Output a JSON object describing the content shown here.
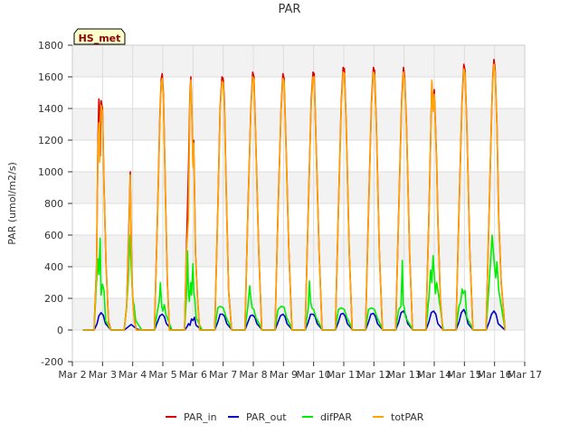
{
  "chart_data": {
    "type": "line",
    "title": "PAR",
    "xlabel": "",
    "ylabel": "PAR (umol/m2/s)",
    "ylim": [
      -200,
      1800
    ],
    "xlim": [
      0,
      15
    ],
    "yticks": [
      -200,
      0,
      200,
      400,
      600,
      800,
      1000,
      1200,
      1400,
      1600,
      1800
    ],
    "xticks": [
      {
        "x": 0,
        "label": "Mar 2"
      },
      {
        "x": 1,
        "label": "Mar 3"
      },
      {
        "x": 2,
        "label": "Mar 4"
      },
      {
        "x": 3,
        "label": "Mar 5"
      },
      {
        "x": 4,
        "label": "Mar 6"
      },
      {
        "x": 5,
        "label": "Mar 7"
      },
      {
        "x": 6,
        "label": "Mar 8"
      },
      {
        "x": 7,
        "label": "Mar 9"
      },
      {
        "x": 8,
        "label": "Mar 10"
      },
      {
        "x": 9,
        "label": "Mar 11"
      },
      {
        "x": 10,
        "label": "Mar 12"
      },
      {
        "x": 11,
        "label": "Mar 13"
      },
      {
        "x": 12,
        "label": "Mar 14"
      },
      {
        "x": 13,
        "label": "Mar 15"
      },
      {
        "x": 14,
        "label": "Mar 16"
      },
      {
        "x": 15,
        "label": "Mar 17"
      }
    ],
    "grid": true,
    "legend_position": "bottom",
    "annotation": "HS_met",
    "series": [
      {
        "name": "PAR_in",
        "color": "#dd0000",
        "x": [
          0.35,
          0.72,
          0.8,
          0.85,
          0.88,
          0.9,
          0.92,
          0.95,
          1.0,
          1.05,
          1.12,
          1.2,
          1.28,
          1.72,
          1.8,
          1.88,
          1.92,
          1.95,
          1.98,
          2.02,
          2.06,
          2.12,
          2.22,
          2.3,
          2.72,
          2.82,
          2.9,
          2.95,
          2.98,
          3.02,
          3.08,
          3.15,
          3.22,
          3.3,
          3.72,
          3.78,
          3.85,
          3.9,
          3.93,
          3.96,
          4.0,
          4.02,
          4.05,
          4.08,
          4.15,
          4.22,
          4.3,
          4.72,
          4.82,
          4.9,
          4.96,
          5.0,
          5.04,
          5.1,
          5.18,
          5.28,
          5.72,
          5.82,
          5.92,
          5.98,
          6.02,
          6.08,
          6.18,
          6.28,
          6.72,
          6.82,
          6.92,
          6.98,
          7.02,
          7.08,
          7.18,
          7.28,
          7.72,
          7.82,
          7.92,
          7.98,
          8.02,
          8.08,
          8.18,
          8.28,
          8.72,
          8.82,
          8.92,
          8.98,
          9.02,
          9.08,
          9.18,
          9.28,
          9.72,
          9.82,
          9.92,
          9.98,
          10.02,
          10.08,
          10.18,
          10.28,
          10.72,
          10.82,
          10.92,
          10.98,
          11.02,
          11.08,
          11.18,
          11.28,
          11.72,
          11.82,
          11.88,
          11.92,
          11.96,
          12.0,
          12.04,
          12.08,
          12.12,
          12.2,
          12.28,
          12.72,
          12.82,
          12.92,
          12.98,
          13.02,
          13.08,
          13.18,
          13.28,
          13.72,
          13.82,
          13.9,
          13.94,
          13.98,
          14.02,
          14.08,
          14.14,
          14.22,
          14.35
        ],
        "y": [
          0,
          0,
          400,
          1200,
          1460,
          1400,
          1100,
          1450,
          1400,
          900,
          400,
          50,
          0,
          0,
          150,
          700,
          1000,
          600,
          300,
          150,
          60,
          0,
          0,
          0,
          0,
          700,
          1350,
          1590,
          1620,
          1480,
          900,
          300,
          0,
          0,
          0,
          500,
          1000,
          1500,
          1600,
          1400,
          1050,
          1200,
          900,
          500,
          200,
          0,
          0,
          0,
          750,
          1400,
          1600,
          1590,
          1450,
          900,
          250,
          0,
          0,
          750,
          1400,
          1630,
          1600,
          1200,
          500,
          0,
          0,
          750,
          1400,
          1620,
          1590,
          1200,
          500,
          0,
          0,
          750,
          1450,
          1630,
          1620,
          1200,
          500,
          0,
          0,
          750,
          1450,
          1660,
          1650,
          1300,
          500,
          0,
          0,
          750,
          1450,
          1660,
          1640,
          1300,
          500,
          0,
          0,
          750,
          1450,
          1660,
          1600,
          1300,
          500,
          0,
          0,
          700,
          1200,
          1570,
          1400,
          1520,
          1300,
          1050,
          700,
          200,
          0,
          0,
          750,
          1450,
          1680,
          1640,
          1300,
          500,
          0,
          0,
          750,
          1350,
          1600,
          1710,
          1650,
          1300,
          700,
          300,
          0
        ]
      },
      {
        "name": "PAR_out",
        "color": "#0000cc",
        "x": [
          0.35,
          0.72,
          0.82,
          0.88,
          0.95,
          1.02,
          1.1,
          1.28,
          1.72,
          1.85,
          1.95,
          2.05,
          2.15,
          2.3,
          2.72,
          2.82,
          2.9,
          2.98,
          3.05,
          3.12,
          3.3,
          3.72,
          3.8,
          3.85,
          3.9,
          3.95,
          4.0,
          4.05,
          4.1,
          4.3,
          4.72,
          4.82,
          4.9,
          4.98,
          5.05,
          5.12,
          5.3,
          5.72,
          5.82,
          5.9,
          5.98,
          6.05,
          6.12,
          6.3,
          6.72,
          6.82,
          6.9,
          6.98,
          7.05,
          7.12,
          7.3,
          7.72,
          7.82,
          7.9,
          7.98,
          8.05,
          8.12,
          8.3,
          8.72,
          8.82,
          8.9,
          8.98,
          9.05,
          9.12,
          9.3,
          9.72,
          9.82,
          9.9,
          9.98,
          10.05,
          10.12,
          10.3,
          10.72,
          10.82,
          10.9,
          10.98,
          11.05,
          11.12,
          11.3,
          11.72,
          11.82,
          11.9,
          11.98,
          12.05,
          12.12,
          12.3,
          12.72,
          12.82,
          12.9,
          12.98,
          13.05,
          13.12,
          13.3,
          13.72,
          13.82,
          13.9,
          13.98,
          14.05,
          14.12,
          14.35
        ],
        "y": [
          0,
          0,
          40,
          90,
          110,
          95,
          40,
          0,
          0,
          20,
          35,
          20,
          5,
          0,
          0,
          50,
          90,
          100,
          85,
          40,
          0,
          0,
          20,
          40,
          30,
          70,
          60,
          80,
          30,
          0,
          0,
          50,
          100,
          100,
          85,
          40,
          0,
          0,
          50,
          90,
          95,
          80,
          40,
          0,
          0,
          50,
          90,
          100,
          85,
          40,
          0,
          0,
          50,
          100,
          100,
          85,
          40,
          0,
          0,
          50,
          100,
          105,
          85,
          40,
          0,
          0,
          50,
          100,
          105,
          85,
          40,
          0,
          0,
          50,
          110,
          120,
          95,
          40,
          0,
          0,
          50,
          110,
          120,
          100,
          40,
          0,
          0,
          50,
          110,
          130,
          100,
          40,
          0,
          0,
          50,
          100,
          120,
          100,
          40,
          0
        ]
      },
      {
        "name": "difPAR",
        "color": "#00ee00",
        "x": [
          0.35,
          0.72,
          0.8,
          0.85,
          0.88,
          0.92,
          0.95,
          1.0,
          1.05,
          1.1,
          1.28,
          1.72,
          1.8,
          1.85,
          1.9,
          1.95,
          2.0,
          2.05,
          2.1,
          2.3,
          2.72,
          2.82,
          2.88,
          2.92,
          2.96,
          3.0,
          3.05,
          3.1,
          3.3,
          3.72,
          3.78,
          3.82,
          3.85,
          3.88,
          3.92,
          3.95,
          4.0,
          4.03,
          4.06,
          4.1,
          4.3,
          4.72,
          4.82,
          4.9,
          5.0,
          5.1,
          5.3,
          5.72,
          5.82,
          5.88,
          5.92,
          5.96,
          6.02,
          6.08,
          6.3,
          6.72,
          6.82,
          6.92,
          7.02,
          7.1,
          7.3,
          7.72,
          7.82,
          7.86,
          7.9,
          7.94,
          8.0,
          8.08,
          8.3,
          8.72,
          8.82,
          8.92,
          9.02,
          9.1,
          9.3,
          9.72,
          9.82,
          9.92,
          10.02,
          10.1,
          10.3,
          10.72,
          10.82,
          10.9,
          10.94,
          10.97,
          11.0,
          11.05,
          11.3,
          11.72,
          11.82,
          11.88,
          11.92,
          11.96,
          12.0,
          12.04,
          12.08,
          12.12,
          12.3,
          12.72,
          12.82,
          12.88,
          12.92,
          12.96,
          13.02,
          13.08,
          13.3,
          13.72,
          13.82,
          13.88,
          13.92,
          13.96,
          14.0,
          14.04,
          14.08,
          14.14,
          14.35
        ],
        "y": [
          0,
          0,
          300,
          450,
          350,
          580,
          220,
          290,
          250,
          60,
          0,
          0,
          150,
          300,
          600,
          400,
          200,
          150,
          60,
          0,
          0,
          120,
          180,
          300,
          150,
          120,
          160,
          100,
          0,
          0,
          200,
          500,
          250,
          180,
          300,
          220,
          420,
          230,
          200,
          80,
          0,
          0,
          140,
          150,
          140,
          80,
          0,
          0,
          150,
          280,
          200,
          140,
          130,
          80,
          0,
          0,
          130,
          150,
          145,
          80,
          0,
          0,
          140,
          310,
          180,
          140,
          130,
          80,
          0,
          0,
          130,
          140,
          130,
          80,
          0,
          0,
          130,
          140,
          130,
          80,
          0,
          0,
          130,
          150,
          440,
          160,
          150,
          80,
          0,
          0,
          200,
          380,
          300,
          470,
          350,
          230,
          300,
          250,
          0,
          0,
          150,
          180,
          260,
          230,
          250,
          80,
          0,
          0,
          300,
          480,
          600,
          500,
          400,
          330,
          430,
          250,
          0
        ]
      },
      {
        "name": "totPAR",
        "color": "#ffa500",
        "x": [
          0.35,
          0.72,
          0.8,
          0.85,
          0.88,
          0.9,
          0.92,
          0.95,
          1.0,
          1.05,
          1.12,
          1.2,
          1.28,
          1.72,
          1.8,
          1.88,
          1.92,
          1.95,
          1.98,
          2.02,
          2.06,
          2.12,
          2.22,
          2.3,
          2.72,
          2.82,
          2.9,
          2.95,
          2.98,
          3.02,
          3.08,
          3.15,
          3.22,
          3.3,
          3.72,
          3.78,
          3.85,
          3.9,
          3.93,
          3.96,
          4.0,
          4.02,
          4.05,
          4.08,
          4.15,
          4.22,
          4.3,
          4.72,
          4.82,
          4.9,
          4.96,
          5.0,
          5.04,
          5.1,
          5.18,
          5.28,
          5.72,
          5.82,
          5.92,
          5.98,
          6.02,
          6.08,
          6.18,
          6.28,
          6.72,
          6.82,
          6.92,
          6.98,
          7.02,
          7.08,
          7.18,
          7.28,
          7.72,
          7.82,
          7.92,
          7.98,
          8.02,
          8.08,
          8.18,
          8.28,
          8.72,
          8.82,
          8.92,
          8.98,
          9.02,
          9.08,
          9.18,
          9.28,
          9.72,
          9.82,
          9.92,
          9.98,
          10.02,
          10.08,
          10.18,
          10.28,
          10.72,
          10.82,
          10.92,
          10.98,
          11.02,
          11.08,
          11.18,
          11.28,
          11.72,
          11.82,
          11.88,
          11.92,
          11.96,
          12.0,
          12.04,
          12.08,
          12.12,
          12.2,
          12.28,
          12.72,
          12.82,
          12.92,
          12.98,
          13.02,
          13.08,
          13.18,
          13.28,
          13.72,
          13.82,
          13.9,
          13.94,
          13.98,
          14.02,
          14.08,
          14.14,
          14.22,
          14.35
        ],
        "y": [
          0,
          0,
          380,
          1150,
          1310,
          1060,
          1300,
          1420,
          1380,
          880,
          390,
          40,
          0,
          0,
          140,
          650,
          980,
          580,
          290,
          140,
          50,
          0,
          0,
          0,
          0,
          680,
          1320,
          1560,
          1590,
          1450,
          880,
          290,
          0,
          0,
          0,
          480,
          700,
          1470,
          1580,
          1380,
          1030,
          1180,
          880,
          490,
          190,
          0,
          0,
          0,
          730,
          1380,
          1570,
          1560,
          1420,
          880,
          240,
          0,
          0,
          730,
          1380,
          1600,
          1580,
          1180,
          490,
          0,
          0,
          730,
          1380,
          1590,
          1570,
          1180,
          490,
          0,
          0,
          730,
          1420,
          1600,
          1600,
          1180,
          490,
          0,
          0,
          730,
          1420,
          1630,
          1620,
          1280,
          490,
          0,
          0,
          730,
          1420,
          1630,
          1610,
          1280,
          490,
          0,
          0,
          730,
          1420,
          1630,
          1580,
          1280,
          490,
          0,
          0,
          680,
          1180,
          1580,
          1380,
          1490,
          1280,
          1030,
          680,
          190,
          0,
          0,
          730,
          1420,
          1650,
          1620,
          1280,
          490,
          0,
          0,
          730,
          1330,
          1580,
          1680,
          1630,
          1280,
          680,
          290,
          0
        ]
      }
    ]
  }
}
